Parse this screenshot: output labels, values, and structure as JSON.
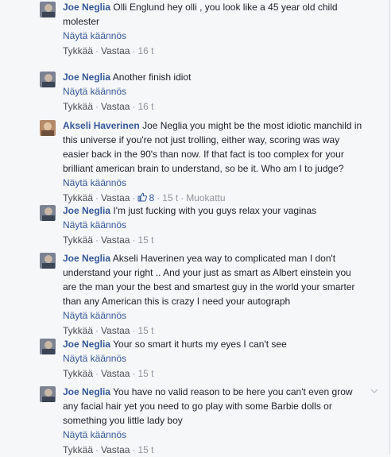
{
  "ui": {
    "translate": "Näytä käännös",
    "like": "Tykkää",
    "reply": "Vastaa",
    "sep": "·"
  },
  "comments": [
    {
      "author": "Joe Neglia",
      "text": "Olli Englund hey olli , you look like a 45 year old child molester",
      "time": "16 t"
    },
    {
      "author": "Joe Neglia",
      "text": "Another finish idiot",
      "time": "16 t"
    },
    {
      "author": "Akseli Haverinen",
      "text": "Joe Neglia you might be the most idiotic manchild in this universe if you're not just trolling, either way, scoring was way easier back in the 90's than now. If that fact is too complex for your brilliant american brain to understand, so be it. Who am I to judge?",
      "likes": "8",
      "time": "15 t",
      "edited": "Muokattu"
    },
    {
      "author": "Joe Neglia",
      "text": "I'm just fucking with you guys relax your vaginas",
      "time": "15 t"
    },
    {
      "author": "Joe Neglia",
      "text": "Akseli Haverinen yea way to complicated man I don't understand your right .. And your just as smart as Albert einstein you are the man your the best and smartest guy in the world your smarter than any American this is crazy I need your autograph",
      "time": "15 t"
    },
    {
      "author": "Joe Neglia",
      "text": "Your so smart it hurts my eyes I can't see",
      "time": "15 t"
    },
    {
      "author": "Joe Neglia",
      "text": "You have no valid reason to be here you can't even grow any facial hair yet you need to go play with some Barbie dolls or something you little lady boy",
      "time": "15 t"
    }
  ],
  "colors": {
    "link": "#365899",
    "meta": "#90949c",
    "background": "#f6f7f9"
  }
}
